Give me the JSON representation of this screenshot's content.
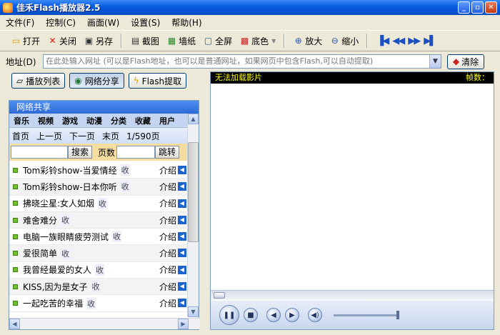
{
  "window": {
    "title": "佳禾Flash播放器2.5",
    "buttons": [
      "_",
      "▫",
      "✕"
    ]
  },
  "menu": [
    "文件(F)",
    "控制(C)",
    "画面(W)",
    "设置(S)",
    "帮助(H)"
  ],
  "toolbar": {
    "open": "打开",
    "close": "关闭",
    "saveas": "另存",
    "screenshot": "截图",
    "wallpaper": "墙纸",
    "fullscreen": "全屏",
    "bgcolor": "底色",
    "zoomin": "放大",
    "zoomout": "缩小"
  },
  "address": {
    "label": "地址(D)",
    "placeholder": "在此处输入网址 (可以是Flash地址，也可以是普通网址，如果网页中包含Flash,可以自动提取)",
    "clear": "清除"
  },
  "tabs": [
    "播放列表",
    "网络分享",
    "Flash提取"
  ],
  "net": {
    "header": "网络共享",
    "categories": [
      "音乐",
      "视频",
      "游戏",
      "动漫",
      "分类",
      "收藏",
      "用户"
    ],
    "pager": {
      "first": "首页",
      "prev": "上一页",
      "next": "下一页",
      "last": "末页",
      "page": "1/590页"
    },
    "search": "搜索",
    "pagenum": "页数",
    "jump": "跳转",
    "fav": "收",
    "intro": "介绍"
  },
  "items": [
    "Tom彩铃show-当爱情经",
    "Tom彩铃show-日本你听",
    "拂晓尘星:女人如烟",
    "难舍难分",
    "电脑一族眼睛疲劳测试",
    "爱很简单",
    "我曾经最爱的女人",
    "KISS,因为是女子",
    "一起吃苦的幸福"
  ],
  "player": {
    "status": "无法加载影片",
    "frames": "帧数："
  }
}
